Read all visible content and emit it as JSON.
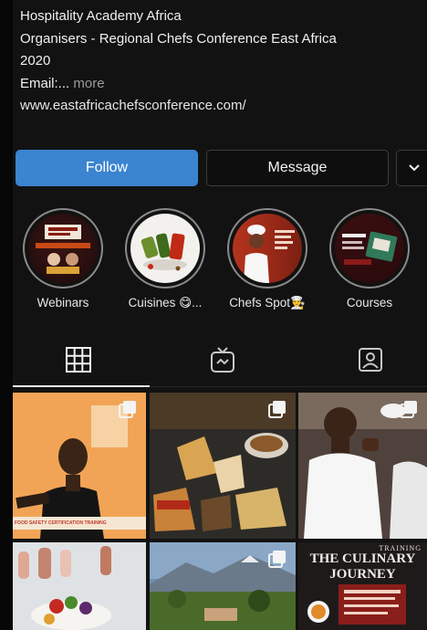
{
  "profile": {
    "bio_lines": [
      "Hospitality Academy Africa",
      "Organisers - Regional Chefs Conference East Africa",
      "2020"
    ],
    "email_label": "Email:...",
    "more_label": " more",
    "website": "www.eastafricachefsconference.com/"
  },
  "actions": {
    "follow_label": "Follow",
    "message_label": "Message"
  },
  "highlights": [
    {
      "label": "Webinars"
    },
    {
      "label": "Cuisines 😋..."
    },
    {
      "label": "Chefs Spot👨‍🍳"
    },
    {
      "label": "Courses"
    }
  ],
  "tabs": [
    {
      "icon": "grid-icon"
    },
    {
      "icon": "igtv-icon"
    },
    {
      "icon": "tagged-icon"
    }
  ],
  "posts": [
    {
      "caption": "FOOD SAFETY CERTIFICATION TRAINING"
    },
    {
      "caption": ""
    },
    {
      "caption": ""
    },
    {
      "caption": ""
    },
    {
      "caption": ""
    },
    {
      "caption": "THE CULINARY JOURNEY",
      "overline": "TRAINING"
    }
  ],
  "colors": {
    "background": "#121212",
    "follow_blue": "#3b84d0",
    "text": "#f2f2f2",
    "muted": "#9a9a9a"
  }
}
